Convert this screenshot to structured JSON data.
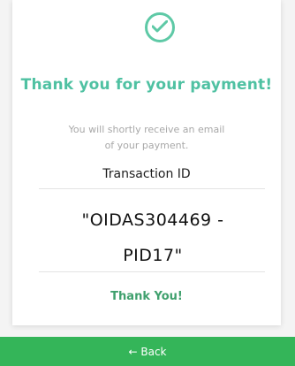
{
  "colors": {
    "accent": "#5ec9a6",
    "title": "#4fc1a2",
    "thanks": "#3fa06d",
    "button": "#34b559"
  },
  "icon": "check-circle-icon",
  "title": "Thank you for your payment!",
  "subtitle_line1": "You will shortly receive an email",
  "subtitle_line2": "of your payment.",
  "transaction_label": "Transaction ID",
  "transaction_id_line1": "\"OIDAS304469 -",
  "transaction_id_line2": "PID17\"",
  "thanks_text": "Thank You!",
  "back_button_label": "← Back"
}
